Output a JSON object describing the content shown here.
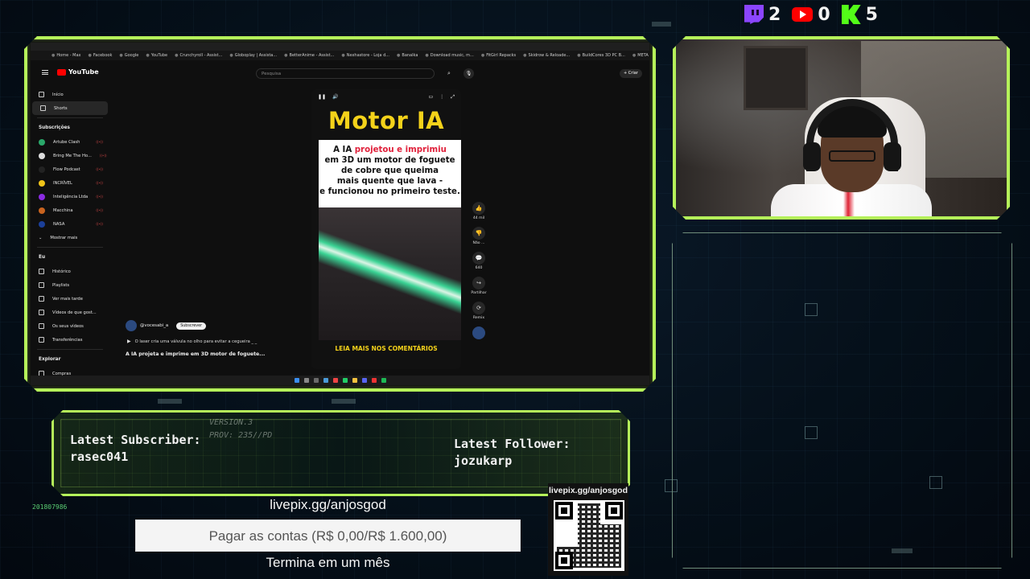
{
  "stats": {
    "twitch": "2",
    "youtube": "0",
    "kick": "5"
  },
  "browser": {
    "bookmarks": [
      "Home - Max",
      "Facebook",
      "Google",
      "YouTube",
      "Crunchyroll - Assist...",
      "Globoplay | Assista...",
      "BetterAnime - Assist...",
      "Nexhastore - Loja d...",
      "Banalka",
      "Download music, m...",
      "FitGirl Repacks",
      "Skidrow & Reloade...",
      "BuildCores 3D PC B...",
      "META do WARZ"
    ],
    "logo": "YouTube",
    "search_placeholder": "Pesquisa",
    "create_label": "Criar"
  },
  "sidebar": {
    "nav": [
      {
        "label": "Início",
        "icon": "home-icon"
      },
      {
        "label": "Shorts",
        "icon": "shorts-icon"
      }
    ],
    "subscriptions_title": "Subscrições",
    "subscriptions": [
      {
        "label": "Artube Clash",
        "color": "#2aa86a"
      },
      {
        "label": "Bring Me The Ho...",
        "color": "#dddddd"
      },
      {
        "label": "Flow Podcast",
        "color": "#222222"
      },
      {
        "label": "INCRÍVEL",
        "color": "#f0c419"
      },
      {
        "label": "Inteligência Ltda",
        "color": "#8b2be2"
      },
      {
        "label": "Macchina",
        "color": "#c9631f"
      },
      {
        "label": "NASA",
        "color": "#1b3f99"
      }
    ],
    "show_more": "Mostrar mais",
    "you_title": "Eu",
    "you_items": [
      {
        "label": "Histórico",
        "icon": "history-icon"
      },
      {
        "label": "Playlists",
        "icon": "playlist-icon"
      },
      {
        "label": "Ver mais tarde",
        "icon": "clock-icon"
      },
      {
        "label": "Vídeos de que gost...",
        "icon": "like-icon"
      },
      {
        "label": "Os seus vídeos",
        "icon": "video-icon"
      },
      {
        "label": "Transferências",
        "icon": "download-icon"
      }
    ],
    "explore_title": "Explorar",
    "explore_items": [
      {
        "label": "Compras",
        "icon": "bag-icon"
      }
    ]
  },
  "short": {
    "title": "Motor IA",
    "card_line1_a": "A IA ",
    "card_line1_b": "projetou e imprimiu",
    "card_rest": [
      "em 3D um motor de foguete",
      "de cobre que queima",
      "mais quente que lava -",
      "e funcionou no primeiro teste."
    ],
    "footer": "LEIA MAIS NOS COMENTÁRIOS",
    "actions": [
      {
        "label": "44 mil",
        "icon": "thumbs-up-icon",
        "glyph": "👍"
      },
      {
        "label": "Não ...",
        "icon": "thumbs-down-icon",
        "glyph": "👎"
      },
      {
        "label": "640",
        "icon": "comment-icon",
        "glyph": "💬"
      },
      {
        "label": "Partilhar",
        "icon": "share-icon",
        "glyph": "↪"
      },
      {
        "label": "Remix",
        "icon": "remix-icon",
        "glyph": "⟳"
      }
    ],
    "channel": "@vocesabi_a",
    "subscribe": "Subscrever",
    "description": "O laser cria uma válvula no olho para  evitar a cegueira _ _",
    "video_title": "A IA projeta e  imprime em 3D motor de foguete..."
  },
  "overlay": {
    "version_line1": "VERSION.3",
    "version_line2": "PROV: 235//PD",
    "latest_subscriber_label": "Latest Subscriber:",
    "latest_subscriber": "rasec041",
    "latest_follower_label": "Latest Follower:",
    "latest_follower": "jozukarp",
    "counter": "201807986",
    "livepix_url": "livepix.gg/anjosgod",
    "goal_text": "Pagar as contas (R$ 0,00/R$ 1.600,00)",
    "goal_progress": 0,
    "goal_ends": "Termina em um mês",
    "qr_label": "livepix.gg/anjosgod"
  }
}
